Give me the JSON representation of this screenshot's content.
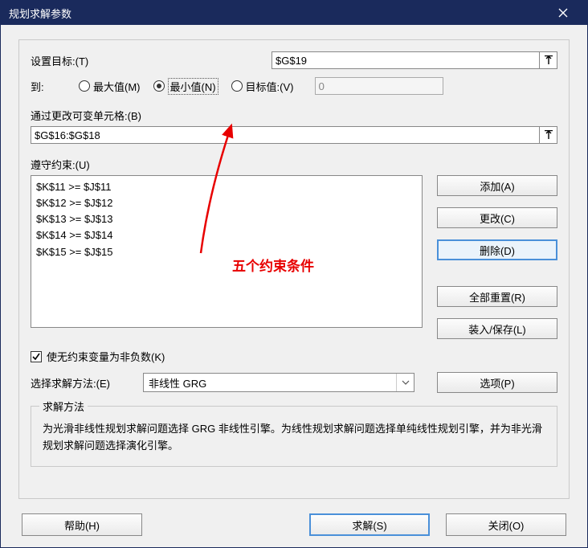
{
  "title": "规划求解参数",
  "objective": {
    "label": "设置目标:(T)",
    "value": "$G$19"
  },
  "to": {
    "label": "到:",
    "max": "最大值(M)",
    "min": "最小值(N)",
    "target": "目标值:(V)",
    "target_value": "0"
  },
  "changing": {
    "label": "通过更改可变单元格:(B)",
    "value": "$G$16:$G$18"
  },
  "constraints": {
    "label": "遵守约束:(U)",
    "items": [
      "$K$11 >= $J$11",
      "$K$12 >= $J$12",
      "$K$13 >= $J$13",
      "$K$14 >= $J$14",
      "$K$15 >= $J$15"
    ],
    "buttons": {
      "add": "添加(A)",
      "change": "更改(C)",
      "delete": "删除(D)",
      "reset": "全部重置(R)",
      "loadsave": "装入/保存(L)"
    },
    "annotation": "五个约束条件"
  },
  "nonneg": {
    "label": "使无约束变量为非负数(K)",
    "checked": true
  },
  "method": {
    "label": "选择求解方法:(E)",
    "selected": "非线性 GRG",
    "options_btn": "选项(P)"
  },
  "method_help": {
    "title": "求解方法",
    "text": "为光滑非线性规划求解问题选择 GRG 非线性引擎。为线性规划求解问题选择单纯线性规划引擎，并为非光滑规划求解问题选择演化引擎。"
  },
  "footer": {
    "help": "帮助(H)",
    "solve": "求解(S)",
    "close": "关闭(O)"
  }
}
